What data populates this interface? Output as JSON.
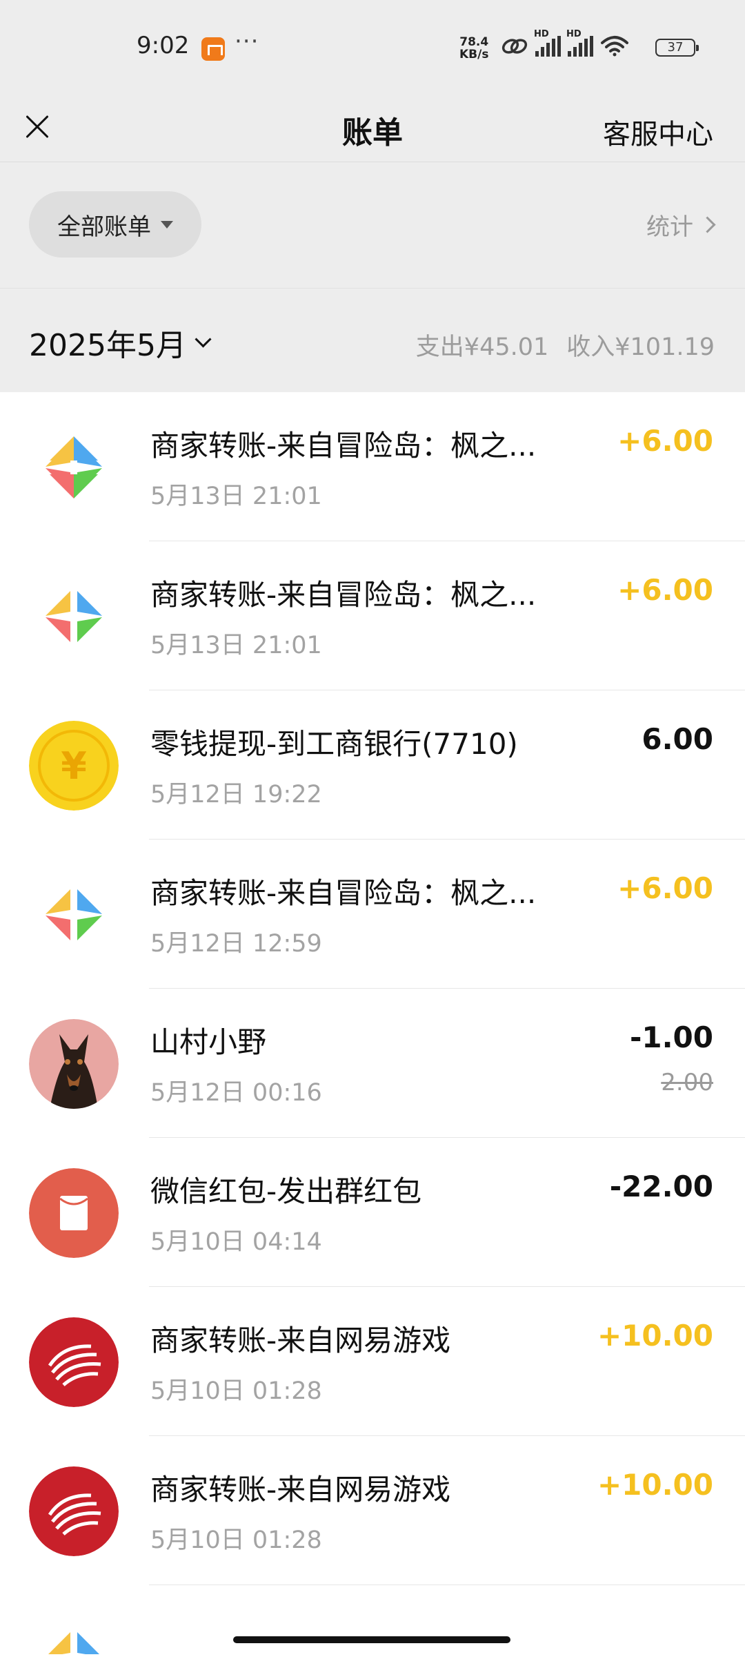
{
  "status_bar": {
    "time": "9:02",
    "net_speed_value": "78.4",
    "net_speed_unit": "KB/s",
    "hd_label": "HD",
    "battery": "37"
  },
  "header": {
    "title": "账单",
    "service_label": "客服中心"
  },
  "filter": {
    "label": "全部账单",
    "stats_label": "统计"
  },
  "month_summary": {
    "month": "2025年5月",
    "expense": "支出¥45.01",
    "income": "收入¥101.19"
  },
  "colors": {
    "income_amount": "#f5c01f",
    "background_gray": "#ededed"
  },
  "transactions": [
    {
      "icon": "merchant-diamond-logo",
      "title": "商家转账-来自冒险岛：枫之...",
      "time": "5月13日 21:01",
      "amount": "+6.00",
      "type": "income"
    },
    {
      "icon": "merchant-diamond-logo",
      "title": "商家转账-来自冒险岛：枫之...",
      "time": "5月13日 21:01",
      "amount": "+6.00",
      "type": "income"
    },
    {
      "icon": "yuan-coin-icon",
      "title": "零钱提现-到工商银行(7710)",
      "time": "5月12日 19:22",
      "amount": "6.00",
      "type": "neutral"
    },
    {
      "icon": "merchant-diamond-logo",
      "title": "商家转账-来自冒险岛：枫之...",
      "time": "5月12日 12:59",
      "amount": "+6.00",
      "type": "income"
    },
    {
      "icon": "dog-avatar",
      "title": "山村小野",
      "time": "5月12日 00:16",
      "amount": "-1.00",
      "original_amount": "2.00",
      "type": "expense"
    },
    {
      "icon": "red-packet-icon",
      "title": "微信红包-发出群红包",
      "time": "5月10日 04:14",
      "amount": "-22.00",
      "type": "expense"
    },
    {
      "icon": "netease-logo",
      "title": "商家转账-来自网易游戏",
      "time": "5月10日 01:28",
      "amount": "+10.00",
      "type": "income"
    },
    {
      "icon": "netease-logo",
      "title": "商家转账-来自网易游戏",
      "time": "5月10日 01:28",
      "amount": "+10.00",
      "type": "income"
    }
  ]
}
